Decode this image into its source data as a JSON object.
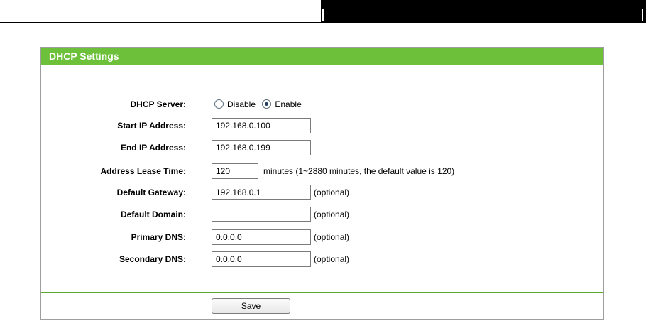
{
  "panel": {
    "title": "DHCP Settings"
  },
  "dhcp_server": {
    "label": "DHCP Server:",
    "options": [
      {
        "label": "Disable",
        "checked": false
      },
      {
        "label": "Enable",
        "checked": true
      }
    ]
  },
  "start_ip": {
    "label": "Start IP Address:",
    "value": "192.168.0.100"
  },
  "end_ip": {
    "label": "End IP Address:",
    "value": "192.168.0.199"
  },
  "lease_time": {
    "label": "Address Lease Time:",
    "value": "120",
    "note": "minutes (1~2880 minutes, the default value is 120)"
  },
  "gateway": {
    "label": "Default Gateway:",
    "value": "192.168.0.1",
    "note": "(optional)"
  },
  "domain": {
    "label": "Default Domain:",
    "value": "",
    "note": "(optional)"
  },
  "primary_dns": {
    "label": "Primary DNS:",
    "value": "0.0.0.0",
    "note": "(optional)"
  },
  "secondary_dns": {
    "label": "Secondary DNS:",
    "value": "0.0.0.0",
    "note": "(optional)"
  },
  "save_label": "Save",
  "colors": {
    "title_bar": "#6dc13a",
    "separator": "#5aa631"
  }
}
